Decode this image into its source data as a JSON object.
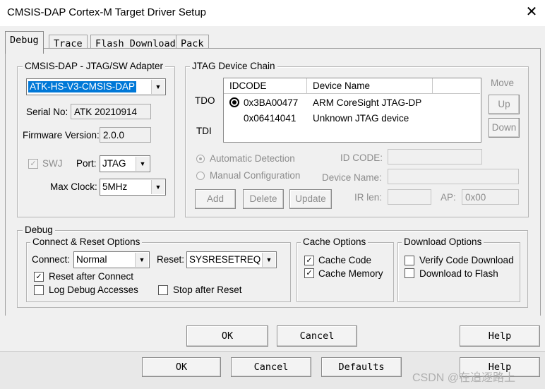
{
  "window": {
    "title": "CMSIS-DAP Cortex-M Target Driver Setup"
  },
  "tabs": [
    {
      "label": "Debug"
    },
    {
      "label": "Trace"
    },
    {
      "label": "Flash Download"
    },
    {
      "label": "Pack"
    }
  ],
  "adapter": {
    "title": "CMSIS-DAP - JTAG/SW Adapter",
    "selected": "ATK-HS-V3-CMSIS-DAP",
    "serial_label": "Serial No:",
    "serial_value": "ATK 20210914",
    "firmware_label": "Firmware Version:",
    "firmware_value": "2.0.0",
    "swj_label": "SWJ",
    "port_label": "Port:",
    "port_value": "JTAG",
    "maxclock_label": "Max Clock:",
    "maxclock_value": "5MHz"
  },
  "chain": {
    "title": "JTAG Device Chain",
    "tdo": "TDO",
    "tdi": "TDI",
    "col_idcode": "IDCODE",
    "col_name": "Device Name",
    "rows": [
      {
        "idcode": "0x3BA00477",
        "name": "ARM CoreSight JTAG-DP",
        "selected": true
      },
      {
        "idcode": "0x06414041",
        "name": "Unknown JTAG device",
        "selected": false
      }
    ],
    "move": "Move",
    "up": "Up",
    "down": "Down",
    "auto_detect": "Automatic Detection",
    "manual_config": "Manual Configuration",
    "id_code_label": "ID CODE:",
    "device_name_label": "Device Name:",
    "ir_len_label": "IR len:",
    "ap_label": "AP:",
    "ap_value": "0x00",
    "add": "Add",
    "delete": "Delete",
    "update": "Update"
  },
  "debug": {
    "title": "Debug",
    "connect_reset": {
      "title": "Connect & Reset Options",
      "connect_label": "Connect:",
      "connect_value": "Normal",
      "reset_label": "Reset:",
      "reset_value": "SYSRESETREQ",
      "reset_after_connect": "Reset after Connect",
      "log_debug": "Log Debug Accesses",
      "stop_after_reset": "Stop after Reset"
    },
    "cache": {
      "title": "Cache Options",
      "cache_code": "Cache Code",
      "cache_memory": "Cache Memory"
    },
    "download": {
      "title": "Download Options",
      "verify": "Verify Code Download",
      "to_flash": "Download to Flash"
    }
  },
  "dialog_buttons": {
    "ok": "OK",
    "cancel": "Cancel",
    "help": "Help"
  },
  "back_buttons": {
    "ok": "OK",
    "cancel": "Cancel",
    "defaults": "Defaults",
    "help": "Help"
  },
  "watermark": "CSDN @在追逐路上"
}
